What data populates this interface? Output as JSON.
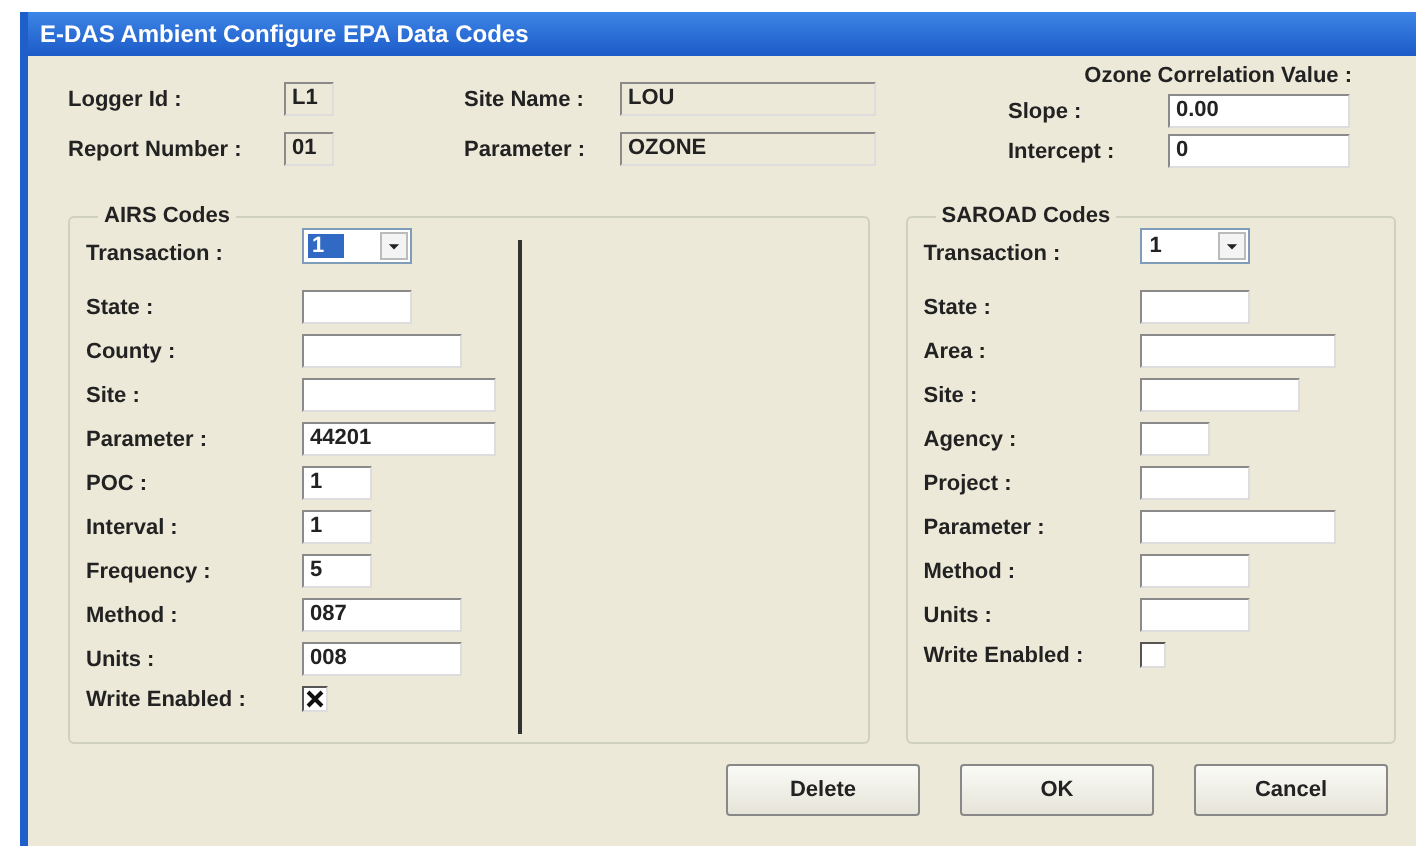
{
  "window": {
    "title": "E-DAS Ambient Configure EPA Data Codes"
  },
  "header": {
    "fields": [
      {
        "label": "Logger Id :",
        "value": "L1",
        "readonly": true
      },
      {
        "label": "Report Number :",
        "value": "01",
        "readonly": true
      },
      {
        "label": "Site Name :",
        "value": "LOU",
        "readonly": true
      },
      {
        "label": "Parameter :",
        "value": "OZONE",
        "readonly": true
      }
    ],
    "ozone": {
      "title": "Ozone Correlation Value :",
      "fields": [
        {
          "label": "Slope :",
          "value": "0.00",
          "readonly": false
        },
        {
          "label": "Intercept :",
          "value": "0",
          "readonly": false
        }
      ]
    }
  },
  "groups": [
    {
      "title": "AIRS Codes",
      "rows": [
        {
          "kind": "combo",
          "label": "Transaction :",
          "value": "1",
          "highlighted": true
        },
        {
          "kind": "text",
          "label": "State :",
          "value": ""
        },
        {
          "kind": "text",
          "label": "County :",
          "value": ""
        },
        {
          "kind": "text",
          "label": "Site :",
          "value": ""
        },
        {
          "kind": "text",
          "label": "Parameter :",
          "value": "44201"
        },
        {
          "kind": "text",
          "label": "POC :",
          "value": "1"
        },
        {
          "kind": "text",
          "label": "Interval :",
          "value": "1"
        },
        {
          "kind": "text",
          "label": "Frequency :",
          "value": "5"
        },
        {
          "kind": "text",
          "label": "Method :",
          "value": "087"
        },
        {
          "kind": "text",
          "label": "Units :",
          "value": "008"
        },
        {
          "kind": "checkbox",
          "label": "Write Enabled :",
          "checked": true
        }
      ]
    },
    {
      "title": "SAROAD Codes",
      "rows": [
        {
          "kind": "combo",
          "label": "Transaction :",
          "value": "1",
          "highlighted": false
        },
        {
          "kind": "text",
          "label": "State :",
          "value": ""
        },
        {
          "kind": "text",
          "label": "Area :",
          "value": ""
        },
        {
          "kind": "text",
          "label": "Site :",
          "value": ""
        },
        {
          "kind": "text",
          "label": "Agency :",
          "value": ""
        },
        {
          "kind": "text",
          "label": "Project :",
          "value": ""
        },
        {
          "kind": "text",
          "label": "Parameter :",
          "value": ""
        },
        {
          "kind": "text",
          "label": "Method :",
          "value": ""
        },
        {
          "kind": "text",
          "label": "Units :",
          "value": ""
        },
        {
          "kind": "checkbox",
          "label": "Write Enabled :",
          "checked": false
        }
      ]
    }
  ],
  "buttons": [
    "Delete",
    "OK",
    "Cancel"
  ]
}
